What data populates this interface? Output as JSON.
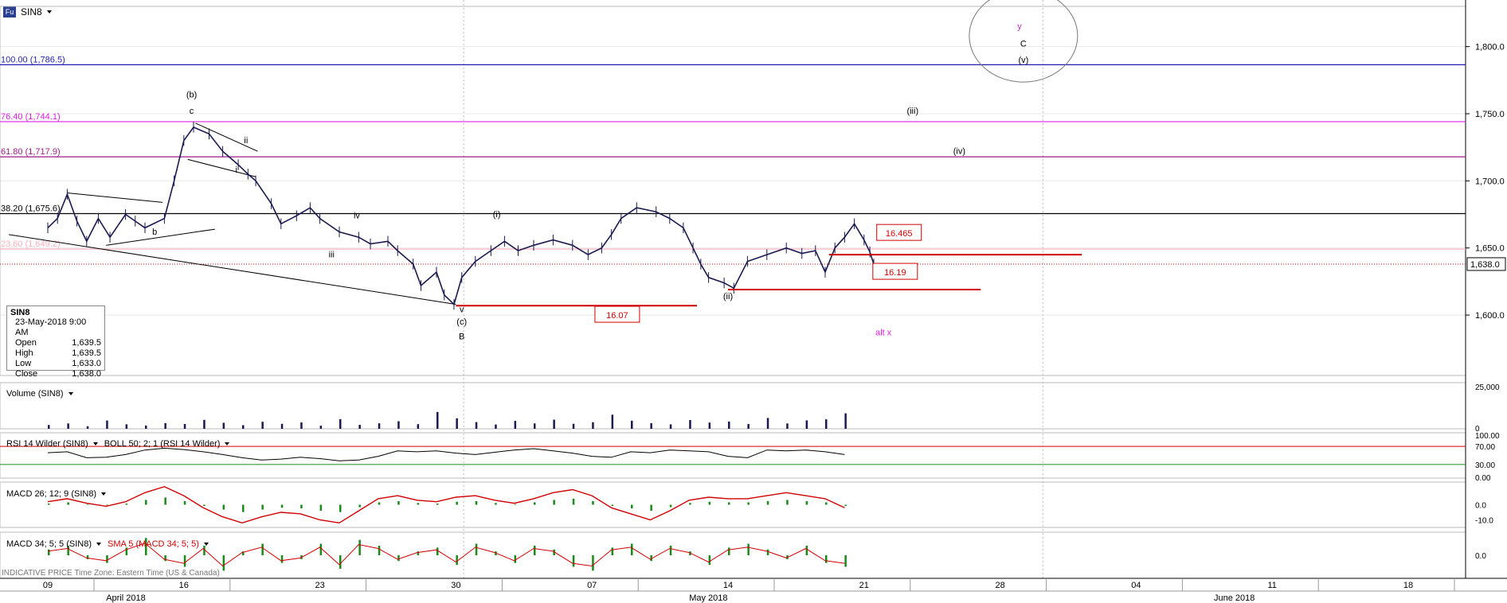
{
  "header": {
    "badge": "Fu",
    "symbol": "SIN8"
  },
  "ohlc": {
    "symbol": "SIN8",
    "datetime": "23-May-2018 9:00 AM",
    "open_label": "Open",
    "open": "1,639.5",
    "high_label": "High",
    "high": "1,639.5",
    "low_label": "Low",
    "low": "1,633.0",
    "close_label": "Close",
    "close": "1,638.0"
  },
  "panels": {
    "volume": {
      "title": "Volume (SIN8)",
      "ticks": [
        "25,000",
        "0"
      ]
    },
    "rsi": {
      "title": "RSI 14 Wilder (SIN8)",
      "boll": "BOLL 50; 2; 1 (RSI 14 Wilder)",
      "ticks": [
        "100.00",
        "70.00",
        "30.00",
        "0.00"
      ]
    },
    "macd1": {
      "title": "MACD 26; 12; 9 (SIN8)",
      "ticks": [
        "0.0",
        "-10.0"
      ]
    },
    "macd2": {
      "title": "MACD 34; 5; 5 (SIN8)",
      "sma": "SMA 5 (MACD 34; 5; 5)",
      "ticks": [
        "0.0"
      ]
    }
  },
  "footer": {
    "indicative": "INDICATIVE PRICE   Time Zone: Eastern Time (US & Canada)"
  },
  "colors": {
    "candle": "#1a1a50",
    "fib_blue": "#1f1fb0",
    "fib_magenta": "#e020e0",
    "fib_purple": "#a01a8a",
    "red": "#d00000",
    "green": "#1a8a1a"
  },
  "chart_data": {
    "type": "line",
    "title": "",
    "ylim": [
      1555,
      1830
    ],
    "y_ticks": [
      "1,800.0",
      "1,750.0",
      "1,700.0",
      "1,650.0",
      "1,600.0"
    ],
    "y_tick_values": [
      1800,
      1750,
      1700,
      1650,
      1600
    ],
    "last_price_label": "1,638.0",
    "last_price": 1638,
    "x_ticks": [
      {
        "label": "09",
        "day": 0
      },
      {
        "label": "16",
        "day": 7
      },
      {
        "label": "23",
        "day": 14
      },
      {
        "label": "30",
        "day": 21
      },
      {
        "label": "07",
        "day": 28
      },
      {
        "label": "14",
        "day": 35
      },
      {
        "label": "21",
        "day": 42
      },
      {
        "label": "28",
        "day": 49
      },
      {
        "label": "04",
        "day": 56
      },
      {
        "label": "11",
        "day": 63
      },
      {
        "label": "18",
        "day": 70
      }
    ],
    "months": [
      {
        "label": "April 2018",
        "day": 3
      },
      {
        "label": "May 2018",
        "day": 33
      },
      {
        "label": "June 2018",
        "day": 60
      }
    ],
    "fib_levels": [
      {
        "label": "100.00 (1,786.5)",
        "value": 1786.5,
        "color": "#1f1fb0"
      },
      {
        "label": "76.40 (1,744.1)",
        "value": 1744.1,
        "color": "#e020e0"
      },
      {
        "label": "61.80 (1,717.9)",
        "value": 1717.9,
        "color": "#a01a8a"
      },
      {
        "label": "38.20 (1,675.6)",
        "value": 1675.6,
        "color": "#000000"
      },
      {
        "label": "23.60 (1,649.2)",
        "value": 1649.2,
        "color": "#ffb0c0"
      }
    ],
    "price_path": [
      [
        0,
        1665
      ],
      [
        0.5,
        1672
      ],
      [
        1,
        1690
      ],
      [
        1.5,
        1670
      ],
      [
        2,
        1655
      ],
      [
        2.6,
        1672
      ],
      [
        3.2,
        1658
      ],
      [
        4,
        1675
      ],
      [
        4.5,
        1670
      ],
      [
        5,
        1665
      ],
      [
        6,
        1672
      ],
      [
        6.5,
        1700
      ],
      [
        7,
        1730
      ],
      [
        7.5,
        1740
      ],
      [
        8.3,
        1735
      ],
      [
        9,
        1722
      ],
      [
        9.8,
        1712
      ],
      [
        10.3,
        1705
      ],
      [
        10.7,
        1700
      ],
      [
        11.5,
        1683
      ],
      [
        12,
        1668
      ],
      [
        12.8,
        1674
      ],
      [
        13.5,
        1680
      ],
      [
        14,
        1672
      ],
      [
        15,
        1662
      ],
      [
        16,
        1658
      ],
      [
        16.6,
        1653
      ],
      [
        17.5,
        1655
      ],
      [
        18,
        1648
      ],
      [
        18.8,
        1638
      ],
      [
        19.2,
        1622
      ],
      [
        20,
        1632
      ],
      [
        20.4,
        1615
      ],
      [
        20.9,
        1608
      ],
      [
        21.3,
        1628
      ],
      [
        22,
        1640
      ],
      [
        22.8,
        1648
      ],
      [
        23.5,
        1655
      ],
      [
        24.2,
        1648
      ],
      [
        25,
        1652
      ],
      [
        26,
        1656
      ],
      [
        27,
        1652
      ],
      [
        27.8,
        1645
      ],
      [
        28.5,
        1650
      ],
      [
        29,
        1660
      ],
      [
        29.5,
        1672
      ],
      [
        30.3,
        1680
      ],
      [
        31.3,
        1677
      ],
      [
        32,
        1672
      ],
      [
        32.7,
        1665
      ],
      [
        33.2,
        1650
      ],
      [
        33.6,
        1638
      ],
      [
        34,
        1628
      ],
      [
        34.8,
        1624
      ],
      [
        35.3,
        1620
      ],
      [
        36,
        1640
      ],
      [
        37,
        1645
      ],
      [
        38,
        1650
      ],
      [
        38.8,
        1646
      ],
      [
        39.5,
        1648
      ],
      [
        40,
        1632
      ],
      [
        40.5,
        1650
      ],
      [
        41,
        1658
      ],
      [
        41.5,
        1668
      ],
      [
        42,
        1656
      ],
      [
        42.3,
        1647
      ],
      [
        42.5,
        1638
      ]
    ],
    "volume": [
      2200,
      3100,
      1500,
      4800,
      2600,
      1900,
      3300,
      2800,
      5200,
      3500,
      2100,
      4100,
      2900,
      3700,
      1800,
      5600,
      2300,
      3200,
      4400,
      2700,
      9800,
      6100,
      3900,
      2500,
      4600,
      3100,
      5300,
      2900,
      3800,
      8200,
      4700,
      3300,
      2600,
      5100,
      3600,
      4200,
      2800,
      6300,
      3100,
      4900,
      5500,
      9000
    ],
    "rsi": [
      56,
      58,
      45,
      46,
      52,
      62,
      66,
      63,
      58,
      52,
      45,
      40,
      42,
      46,
      43,
      38,
      40,
      48,
      60,
      58,
      60,
      55,
      52,
      57,
      62,
      65,
      60,
      55,
      48,
      46,
      58,
      56,
      62,
      60,
      58,
      48,
      45,
      62,
      60,
      62,
      58,
      52
    ],
    "macd1": [
      2,
      4,
      1,
      -1,
      2,
      8,
      12,
      6,
      -2,
      -8,
      -12,
      -8,
      -5,
      -6,
      -10,
      -12,
      -4,
      4,
      6,
      3,
      2,
      5,
      6,
      3,
      1,
      4,
      8,
      10,
      6,
      -2,
      -6,
      -10,
      -4,
      3,
      5,
      4,
      4,
      6,
      8,
      6,
      4,
      -2
    ],
    "macd2": [
      3,
      5,
      -2,
      -4,
      4,
      9,
      -3,
      -6,
      5,
      -8,
      2,
      6,
      -4,
      -2,
      6,
      -7,
      8,
      5,
      -3,
      2,
      4,
      -5,
      6,
      2,
      -4,
      5,
      3,
      -6,
      -8,
      4,
      6,
      -3,
      5,
      2,
      -5,
      4,
      6,
      3,
      -2,
      5,
      -4,
      -6
    ],
    "annotations": [
      {
        "text": "(b)",
        "day": 7.4,
        "value": 1762,
        "color": "#000"
      },
      {
        "text": "c",
        "day": 7.4,
        "value": 1750,
        "color": "#000"
      },
      {
        "text": "ii",
        "day": 10.2,
        "value": 1728,
        "color": "#000"
      },
      {
        "text": "i",
        "day": 9.7,
        "value": 1706,
        "color": "#000"
      },
      {
        "text": "b",
        "day": 5.5,
        "value": 1660,
        "color": "#000"
      },
      {
        "text": "iv",
        "day": 15.9,
        "value": 1672,
        "color": "#000"
      },
      {
        "text": "iii",
        "day": 14.6,
        "value": 1643,
        "color": "#000"
      },
      {
        "text": "v",
        "day": 21.3,
        "value": 1602,
        "color": "#000"
      },
      {
        "text": "(c)",
        "day": 21.3,
        "value": 1593,
        "color": "#000"
      },
      {
        "text": "B",
        "day": 21.3,
        "value": 1582,
        "color": "#000"
      },
      {
        "text": "(i)",
        "day": 23.1,
        "value": 1673,
        "color": "#000"
      },
      {
        "text": "(ii)",
        "day": 35.0,
        "value": 1612,
        "color": "#000"
      },
      {
        "text": "(iii)",
        "day": 44.5,
        "value": 1750,
        "color": "#000"
      },
      {
        "text": "(iv)",
        "day": 46.9,
        "value": 1720,
        "color": "#000"
      },
      {
        "text": "y",
        "day": 50.0,
        "value": 1813,
        "color": "#c030c0"
      },
      {
        "text": "C",
        "day": 50.2,
        "value": 1800,
        "color": "#000"
      },
      {
        "text": "(v)",
        "day": 50.2,
        "value": 1788,
        "color": "#000"
      },
      {
        "text": "alt x",
        "day": 43.0,
        "value": 1585,
        "color": "#e020e0"
      }
    ],
    "targets": [
      {
        "label": "16.465",
        "value": 1645,
        "from_day": 40.2,
        "to_day": 53.2,
        "box_day": 43.8,
        "box_value": 1661
      },
      {
        "label": "16.19",
        "value": 1619,
        "from_day": 35.0,
        "to_day": 48.0,
        "box_day": 43.6,
        "box_value": 1632
      },
      {
        "label": "16.07",
        "value": 1607,
        "from_day": 21.0,
        "to_day": 33.4,
        "box_day": 29.3,
        "box_value": 1600
      }
    ]
  }
}
